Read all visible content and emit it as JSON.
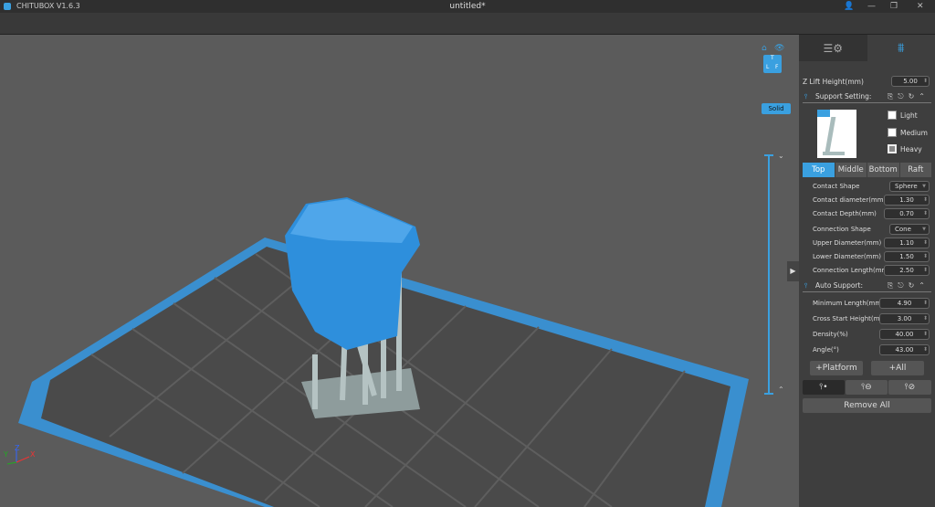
{
  "app": {
    "title": "CHITUBOX V1.6.3",
    "document": "untitled*"
  },
  "window_controls": {
    "user": "👤",
    "minimize": "—",
    "restore": "❐",
    "close": "✕"
  },
  "viewport": {
    "render_mode": "Solid",
    "axes": {
      "x": "X",
      "y": "Y",
      "z": "Z"
    },
    "view_cube": {
      "top": "T",
      "left": "L",
      "front": "F"
    }
  },
  "panel": {
    "z_lift": {
      "label": "Z Lift Height(mm)",
      "value": "5.00"
    },
    "support_setting": {
      "label": "Support Setting:",
      "presets": [
        "Light",
        "Medium",
        "Heavy"
      ],
      "selected": "Heavy"
    },
    "tabs": [
      "Top",
      "Middle",
      "Bottom",
      "Raft"
    ],
    "active_tab": "Top",
    "top_params": [
      {
        "label": "Contact Shape",
        "value": "Sphere",
        "type": "select"
      },
      {
        "label": "Contact diameter(mm)",
        "value": "1.30"
      },
      {
        "label": "Contact Depth(mm)",
        "value": "0.70"
      },
      {
        "label": "Connection Shape",
        "value": "Cone",
        "type": "select"
      },
      {
        "label": "Upper Diameter(mm)",
        "value": "1.10"
      },
      {
        "label": "Lower Diameter(mm)",
        "value": "1.50"
      },
      {
        "label": "Connection Length(mm)",
        "value": "2.50"
      }
    ],
    "auto_support": {
      "label": "Auto Support:",
      "params": [
        {
          "label": "Minimum Length(mm)",
          "value": "4.90"
        },
        {
          "label": "Cross Start Height(mm)",
          "value": "3.00"
        },
        {
          "label": "Density(%)",
          "value": "40.00"
        },
        {
          "label": "Angle(°)",
          "value": "43.00"
        }
      ]
    },
    "buttons": {
      "platform": "+Platform",
      "all": "+All",
      "remove_all": "Remove All"
    }
  }
}
